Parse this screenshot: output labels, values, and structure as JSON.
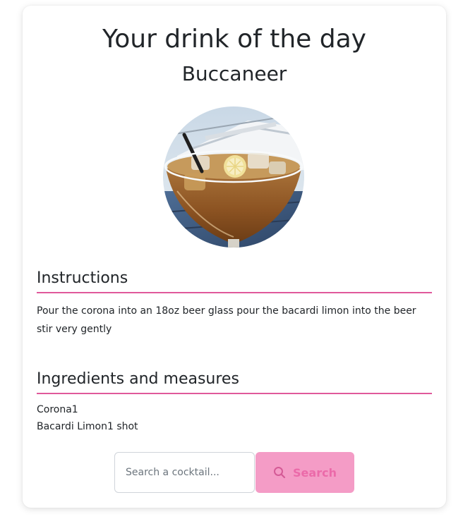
{
  "header": {
    "title": "Your drink of the day",
    "drink_name": "Buccaneer"
  },
  "photo": {
    "alt": "Buccaneer",
    "icon": "cocktail-photo"
  },
  "instructions": {
    "heading": "Instructions",
    "text": "Pour the corona into an 18oz beer glass pour the bacardi limon into the beer stir very gently"
  },
  "ingredients": {
    "heading": "Ingredients and measures",
    "items": [
      "Corona1",
      "Bacardi Limon1 shot"
    ]
  },
  "search": {
    "placeholder": "Search a cocktail...",
    "button_label": "Search",
    "icon": "search-icon"
  },
  "colors": {
    "accent_line": "#e0599b",
    "button_bg": "#f49cc6",
    "button_text": "#eb6aa9"
  }
}
